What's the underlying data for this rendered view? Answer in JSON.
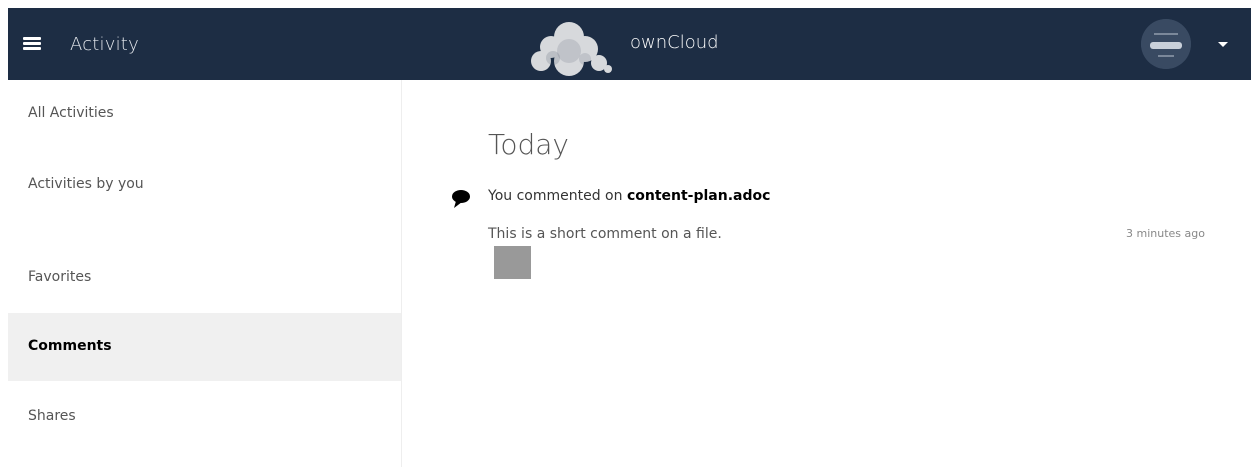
{
  "header": {
    "app_title": "Activity",
    "brand": "ownCloud",
    "menu_icon": "hamburger-menu-icon",
    "logo_icon": "owncloud-cloud-logo",
    "avatar_icon": "user-avatar",
    "dropdown_icon": "caret-down-icon",
    "colors": {
      "bar": "#1d2d44"
    }
  },
  "sidebar": {
    "items": [
      {
        "label": "All Activities",
        "active": false
      },
      {
        "label": "Activities by you",
        "active": false
      },
      {
        "label": "Favorites",
        "active": false
      },
      {
        "label": "Comments",
        "active": true
      },
      {
        "label": "Shares",
        "active": false
      }
    ]
  },
  "main": {
    "section_title": "Today",
    "activity": {
      "icon": "comment-icon",
      "subject_prefix": "You commented on ",
      "file": "content-plan.adoc",
      "message": "This is a short comment on a file.",
      "time": "3 minutes ago",
      "thumbnail_icon": "file-thumbnail"
    }
  }
}
